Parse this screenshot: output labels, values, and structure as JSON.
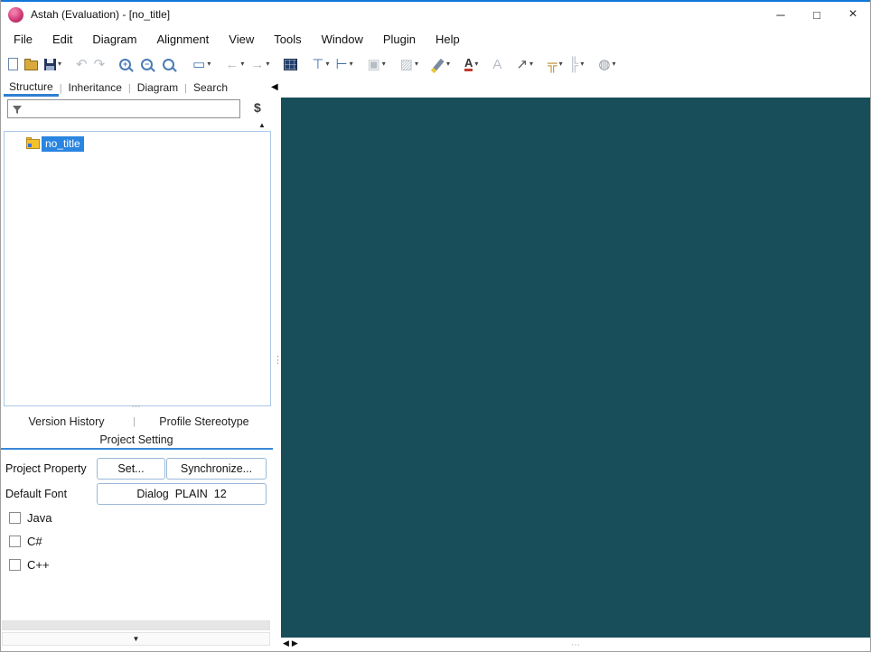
{
  "window": {
    "title": "Astah (Evaluation) - [no_title]",
    "controls": {
      "minimize": "─",
      "maximize": "□",
      "close": "×"
    }
  },
  "menubar": {
    "items": [
      "File",
      "Edit",
      "Diagram",
      "Alignment",
      "View",
      "Tools",
      "Window",
      "Plugin",
      "Help"
    ]
  },
  "toolbar": {
    "buttons": [
      {
        "name": "new-file",
        "glyph": "",
        "dropdown": false,
        "disabled": false
      },
      {
        "name": "open-project",
        "glyph": "",
        "dropdown": false,
        "disabled": false
      },
      {
        "name": "save",
        "glyph": "",
        "dropdown": true,
        "disabled": false
      },
      {
        "name": "undo",
        "glyph": "↶",
        "dropdown": false,
        "disabled": true
      },
      {
        "name": "redo",
        "glyph": "↷",
        "dropdown": false,
        "disabled": true
      },
      {
        "name": "zoom-in",
        "glyph": "+",
        "dropdown": false,
        "disabled": false
      },
      {
        "name": "zoom-out",
        "glyph": "−",
        "dropdown": false,
        "disabled": false
      },
      {
        "name": "zoom-reset",
        "glyph": "",
        "dropdown": false,
        "disabled": false
      },
      {
        "name": "view-frame",
        "glyph": "▭",
        "dropdown": true,
        "disabled": false
      },
      {
        "name": "back",
        "glyph": "←",
        "dropdown": true,
        "disabled": true
      },
      {
        "name": "forward",
        "glyph": "→",
        "dropdown": true,
        "disabled": true
      },
      {
        "name": "map-overview",
        "glyph": "",
        "dropdown": false,
        "disabled": false
      },
      {
        "name": "align-top",
        "glyph": "⊤",
        "dropdown": true,
        "disabled": false
      },
      {
        "name": "align-left",
        "glyph": "⊢",
        "dropdown": true,
        "disabled": false
      },
      {
        "name": "layer-order",
        "glyph": "▣",
        "dropdown": true,
        "disabled": true
      },
      {
        "name": "fill-color",
        "glyph": "▨",
        "dropdown": true,
        "disabled": true
      },
      {
        "name": "highlighter",
        "glyph": "",
        "dropdown": true,
        "disabled": false
      },
      {
        "name": "font-color",
        "glyph": "A",
        "dropdown": true,
        "disabled": false
      },
      {
        "name": "font",
        "glyph": "A",
        "dropdown": false,
        "disabled": true
      },
      {
        "name": "line-style",
        "glyph": "↗",
        "dropdown": true,
        "disabled": false
      },
      {
        "name": "tree-layout-vertical",
        "glyph": "╦",
        "dropdown": true,
        "disabled": false
      },
      {
        "name": "tree-layout-horizontal",
        "glyph": "╠",
        "dropdown": true,
        "disabled": true
      },
      {
        "name": "globe",
        "glyph": "◍",
        "dropdown": true,
        "disabled": false
      }
    ]
  },
  "side_panel": {
    "tabs": [
      {
        "label": "Structure",
        "active": true
      },
      {
        "label": "Inheritance",
        "active": false
      },
      {
        "label": "Diagram",
        "active": false
      },
      {
        "label": "Search",
        "active": false
      }
    ],
    "filter": {
      "value": "",
      "refresh_glyph": "$"
    },
    "tree": {
      "items": [
        {
          "label": "no_title",
          "selected": true
        }
      ]
    },
    "lower_tabs": {
      "row1": [
        "Version History",
        "Profile Stereotype"
      ],
      "row2": [
        "Project Setting"
      ]
    },
    "project_setting": {
      "property_label": "Project Property",
      "set_button": "Set...",
      "synchronize_button": "Synchronize...",
      "font_label": "Default Font",
      "font_button": "Dialog  PLAIN  12",
      "languages": [
        {
          "label": "Java",
          "checked": false
        },
        {
          "label": "C#",
          "checked": false
        },
        {
          "label": "C++",
          "checked": false
        }
      ]
    }
  },
  "ui": {
    "dropdown_arrow": "▾",
    "tab_separator": "|",
    "collapse_left_arrow": "◀",
    "collapse_up_arrow": "▲",
    "collapse_down_arrow": "▼",
    "splitter_dots_h": "⋯",
    "splitter_dots_v": "⋮",
    "scroll_left_arrow": "◀",
    "scroll_right_arrow": "▶"
  },
  "colors": {
    "title_accent": "#1177d7",
    "tab_accent": "#2f7fd0",
    "selection": "#2a85e0",
    "canvas_background": "#174e59"
  }
}
